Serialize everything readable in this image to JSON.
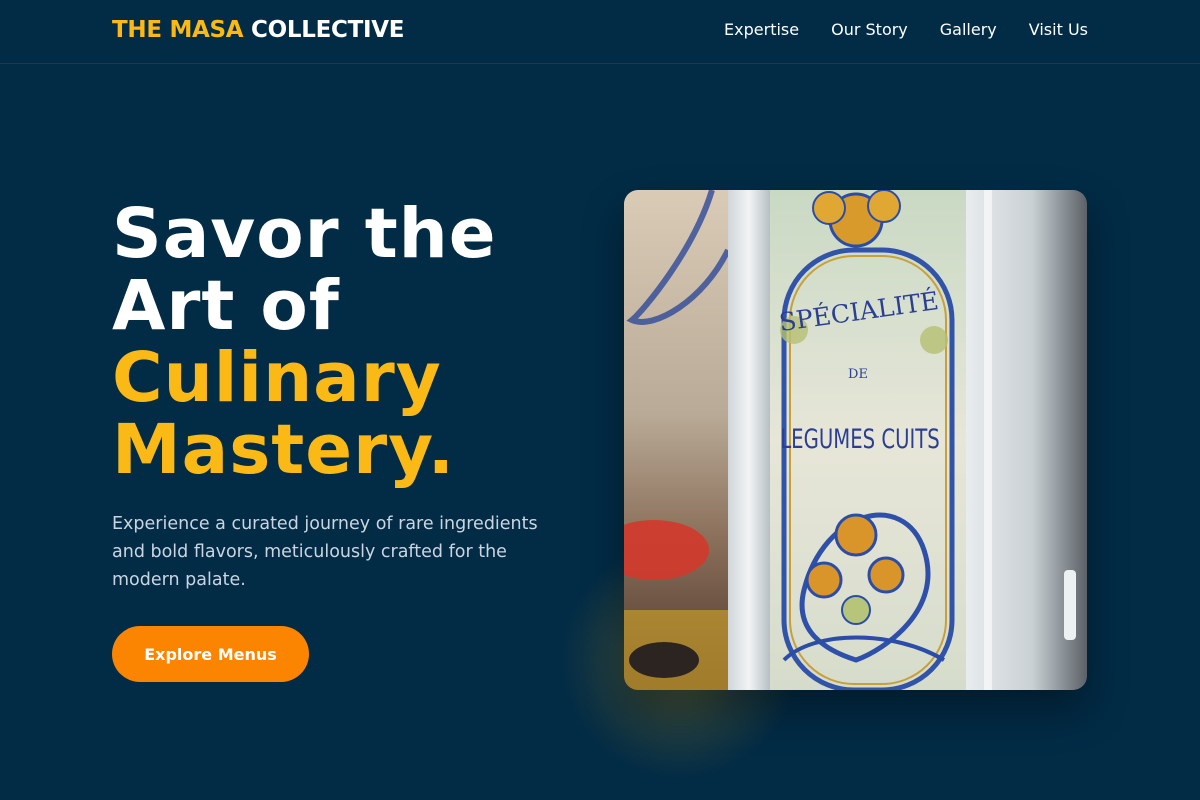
{
  "brand": {
    "accent": "THE MASA",
    "rest": "COLLECTIVE",
    "accent_color": "#fbb915"
  },
  "nav": {
    "items": [
      {
        "label": "Expertise"
      },
      {
        "label": "Our Story"
      },
      {
        "label": "Gallery"
      },
      {
        "label": "Visit Us"
      }
    ]
  },
  "hero": {
    "headline_lines": [
      "Savor the",
      "Art of"
    ],
    "headline_accent_lines": [
      "Culinary",
      "Mastery."
    ],
    "lead": "Experience a curated journey of rare ingredients and bold flavors, meticulously crafted for the modern palate.",
    "cta_label": "Explore Menus",
    "cta_color": "#fb8500",
    "background_color": "#022b45"
  },
  "photo": {
    "sign_top": "SPÉCIALITÉ",
    "sign_mid": "DE",
    "sign_bottom": "LEGUMES CUITS"
  }
}
